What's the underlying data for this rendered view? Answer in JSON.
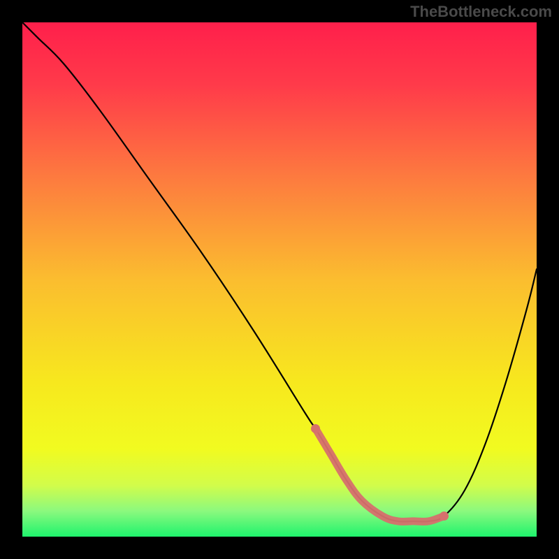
{
  "watermark": "TheBottleneck.com",
  "chart_data": {
    "type": "line",
    "title": "",
    "xlabel": "",
    "ylabel": "",
    "xlim": [
      0,
      100
    ],
    "ylim": [
      0,
      100
    ],
    "gradient_stops": [
      {
        "offset": 0.0,
        "color": "#ff1f4b"
      },
      {
        "offset": 0.12,
        "color": "#ff3a4a"
      },
      {
        "offset": 0.3,
        "color": "#fd7a3f"
      },
      {
        "offset": 0.5,
        "color": "#fbbd2f"
      },
      {
        "offset": 0.7,
        "color": "#f7e81e"
      },
      {
        "offset": 0.83,
        "color": "#f1fb20"
      },
      {
        "offset": 0.9,
        "color": "#d2fc4a"
      },
      {
        "offset": 0.95,
        "color": "#8cf97e"
      },
      {
        "offset": 1.0,
        "color": "#1ef36d"
      }
    ],
    "series": [
      {
        "name": "bottleneck-curve",
        "color": "#000000",
        "width": 2.2,
        "x": [
          0,
          3,
          8,
          15,
          25,
          35,
          45,
          55,
          57,
          60,
          63,
          66,
          70,
          73,
          76,
          79,
          82,
          86,
          90,
          94,
          98,
          100
        ],
        "y": [
          100,
          97,
          92,
          83,
          69,
          55,
          40,
          24,
          21,
          16,
          11,
          7,
          4,
          3,
          3,
          3,
          4,
          9,
          18,
          30,
          44,
          52
        ]
      }
    ],
    "flat_band": {
      "name": "optimal-range",
      "color": "#d6706d",
      "width": 11,
      "x": [
        57,
        60,
        63,
        66,
        70,
        73,
        76,
        79,
        82
      ],
      "y": [
        21,
        16,
        11,
        7,
        4,
        3,
        3,
        3,
        4
      ],
      "endpoints": [
        {
          "x": 57,
          "y": 21
        },
        {
          "x": 82,
          "y": 4
        }
      ]
    }
  }
}
